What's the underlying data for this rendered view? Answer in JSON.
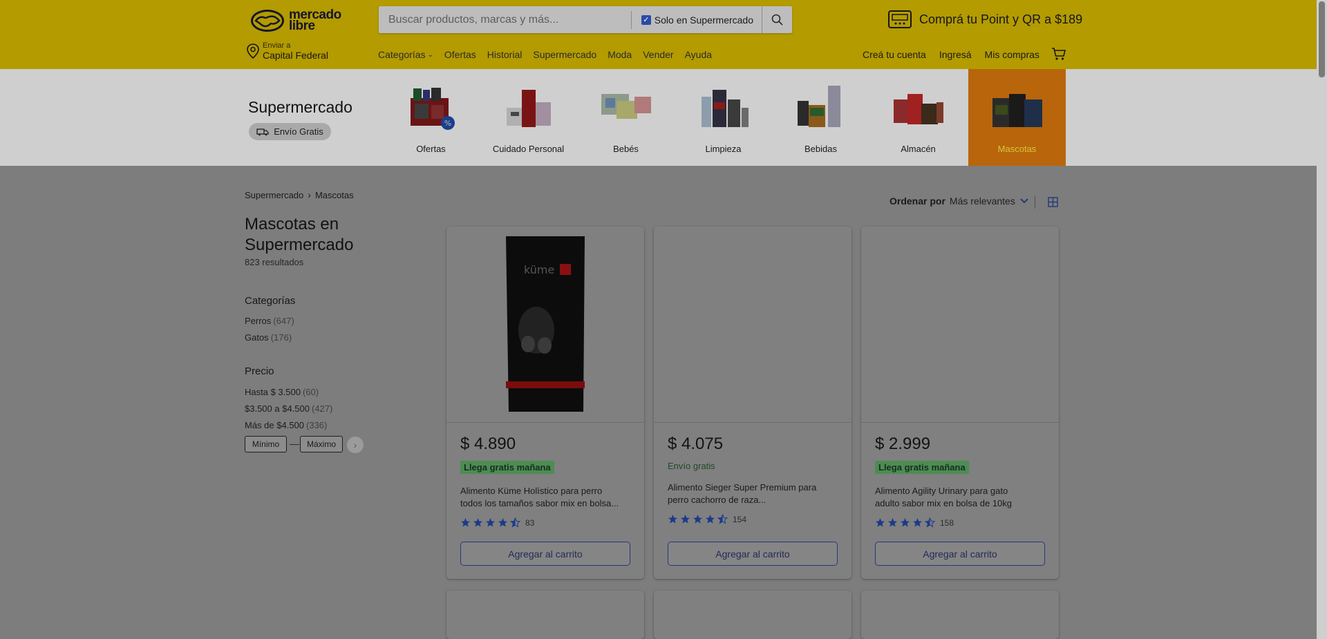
{
  "header": {
    "logo_line1": "mercado",
    "logo_line2": "libre",
    "search_placeholder": "Buscar productos, marcas y más...",
    "solo_supermercado": "Solo en Supermercado",
    "promo": "Comprá tu Point y QR a $189",
    "enviar_label": "Enviar a",
    "enviar_location": "Capital Federal",
    "nav": [
      "Categorías",
      "Ofertas",
      "Historial",
      "Supermercado",
      "Moda",
      "Vender",
      "Ayuda"
    ],
    "account": [
      "Creá tu cuenta",
      "Ingresá",
      "Mis compras"
    ]
  },
  "strip": {
    "title": "Supermercado",
    "envio": "Envío Gratis",
    "categories": [
      "Ofertas",
      "Cuidado Personal",
      "Bebés",
      "Limpieza",
      "Bebidas",
      "Almacén",
      "Mascotas"
    ],
    "active_index": 6
  },
  "sidebar": {
    "breadcrumb": [
      "Supermercado",
      "Mascotas"
    ],
    "title": "Mascotas en Supermercado",
    "results": "823 resultados",
    "categorias_title": "Categorías",
    "categorias": [
      {
        "label": "Perros",
        "count": "(647)"
      },
      {
        "label": "Gatos",
        "count": "(176)"
      }
    ],
    "precio_title": "Precio",
    "precios": [
      {
        "label": "Hasta $ 3.500",
        "count": "(60)"
      },
      {
        "label": "$3.500 a $4.500",
        "count": "(427)"
      },
      {
        "label": "Más de $4.500",
        "count": "(336)"
      }
    ],
    "min_placeholder": "Mínimo",
    "max_placeholder": "Máximo",
    "dash": "—"
  },
  "sort": {
    "label": "Ordenar por",
    "value": "Más relevantes"
  },
  "products": [
    {
      "price": "$ 4.890",
      "badge": "Llega gratis mañana",
      "name_line1": "Alimento Küme Holístico para perro",
      "name_line2": "todos los tamaños sabor mix en bolsa...",
      "rating": 4.5,
      "reviews": "83",
      "add": "Agregar al carrito",
      "image": "kume-dog-food-bag"
    },
    {
      "price": "$ 4.075",
      "badge": "Envío gratis",
      "name_line1": "Alimento Sieger Super Premium para",
      "name_line2": "perro cachorro de raza...",
      "rating": 4.5,
      "reviews": "154",
      "add": "Agregar al carrito",
      "image": ""
    },
    {
      "price": "$ 2.999",
      "badge": "Llega gratis mañana",
      "name_line1": "Alimento Agility Urinary para gato",
      "name_line2": "adulto sabor mix en bolsa de 10kg",
      "rating": 4.5,
      "reviews": "158",
      "add": "Agregar al carrito",
      "image": ""
    }
  ],
  "colors": {
    "header_bg": "#b39b00",
    "active_category_bg": "#b8650c",
    "accent_blue": "#223a7a",
    "badge_green": "#4d8c54"
  }
}
